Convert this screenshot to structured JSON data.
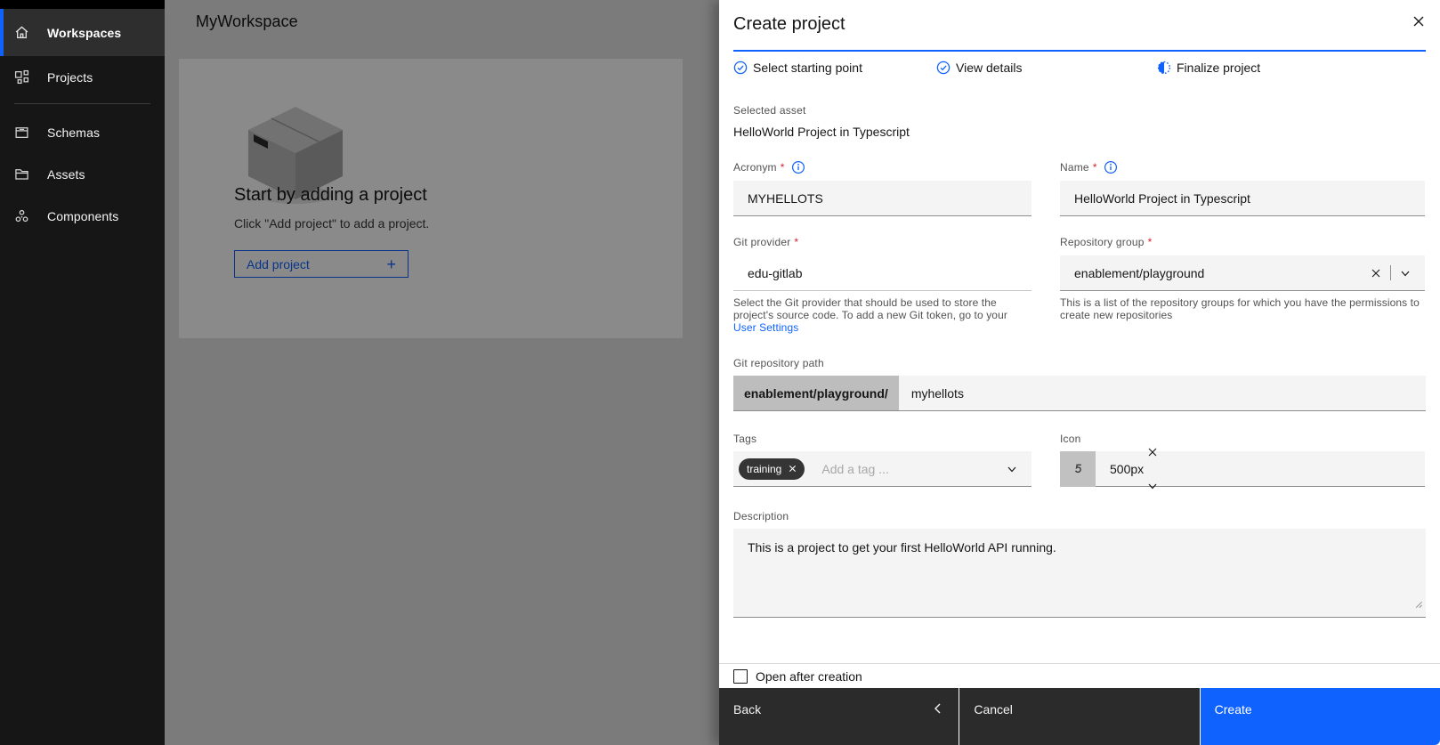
{
  "sidebar": {
    "items": [
      {
        "label": "Workspaces",
        "icon": "home-icon",
        "active": true
      },
      {
        "label": "Projects",
        "icon": "projects-icon",
        "active": false
      },
      {
        "label": "Schemas",
        "icon": "schemas-icon",
        "active": false
      },
      {
        "label": "Assets",
        "icon": "assets-icon",
        "active": false
      },
      {
        "label": "Components",
        "icon": "components-icon",
        "active": false
      }
    ]
  },
  "main": {
    "title": "MyWorkspace",
    "empty_state": {
      "heading": "Start by adding a project",
      "message": "Click \"Add project\" to add a project.",
      "button_label": "Add project",
      "button_icon": "+"
    }
  },
  "panel": {
    "title": "Create project",
    "required_marker": "*",
    "steps": [
      {
        "label": "Select starting point",
        "state": "complete"
      },
      {
        "label": "View details",
        "state": "complete"
      },
      {
        "label": "Finalize project",
        "state": "current"
      }
    ],
    "selected_asset": {
      "label": "Selected asset",
      "value": "HelloWorld Project in Typescript"
    },
    "acronym": {
      "label": "Acronym",
      "value": "MYHELLOTS"
    },
    "name": {
      "label": "Name",
      "value": "HelloWorld Project in Typescript"
    },
    "git_provider": {
      "label": "Git provider",
      "value": "edu-gitlab",
      "helper_text": "Select the Git provider that should be used to store the project's source code. To add a new Git token, go to your ",
      "helper_link": "User Settings"
    },
    "repository_group": {
      "label": "Repository group",
      "value": "enablement/playground",
      "helper_text": "This is a list of the repository groups for which you have the permissions to create new repositories"
    },
    "git_repository_path": {
      "label": "Git repository path",
      "prefix": "enablement/playground/",
      "value": "myhellots"
    },
    "tags": {
      "label": "Tags",
      "tag": "training",
      "placeholder": "Add a tag ..."
    },
    "icon": {
      "label": "Icon",
      "value": "500px"
    },
    "description": {
      "label": "Description",
      "value": "This is a project to get your first HelloWorld API running."
    },
    "footer": {
      "checkbox_label": "Open after creation",
      "back_label": "Back",
      "cancel_label": "Cancel",
      "create_label": "Create"
    }
  },
  "colors": {
    "accent": "#0f62fe",
    "danger": "#da1e28",
    "sidebar_bg": "#161616",
    "panel_bg": "#ffffff",
    "field_bg": "#f4f4f4",
    "secondary_button": "#2b2b2b",
    "tag_bg": "#353535"
  }
}
